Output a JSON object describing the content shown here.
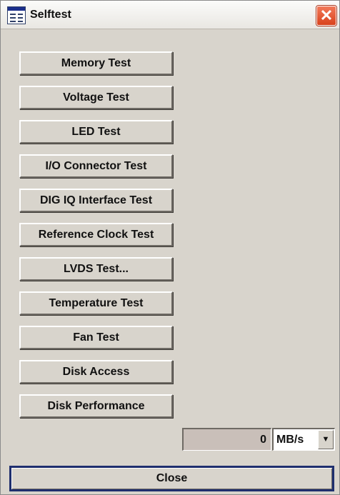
{
  "window": {
    "title": "Selftest",
    "app_icon": "window-app-icon",
    "close_icon": "close-icon"
  },
  "tests": [
    {
      "label": "Memory Test"
    },
    {
      "label": "Voltage Test"
    },
    {
      "label": "LED Test"
    },
    {
      "label": "I/O Connector Test"
    },
    {
      "label": "DIG IQ Interface Test"
    },
    {
      "label": "Reference Clock Test"
    },
    {
      "label": "LVDS Test..."
    },
    {
      "label": "Temperature Test"
    },
    {
      "label": "Fan Test"
    },
    {
      "label": "Disk Access"
    },
    {
      "label": "Disk Performance"
    }
  ],
  "disk_rate": {
    "value": "0",
    "unit": "MB/s",
    "dropdown_icon": "chevron-down-icon"
  },
  "footer": {
    "close_label": "Close"
  },
  "colors": {
    "background": "#d8d4cc",
    "close_title_button": "#d9421c",
    "focus_border": "#1f2f6e"
  }
}
